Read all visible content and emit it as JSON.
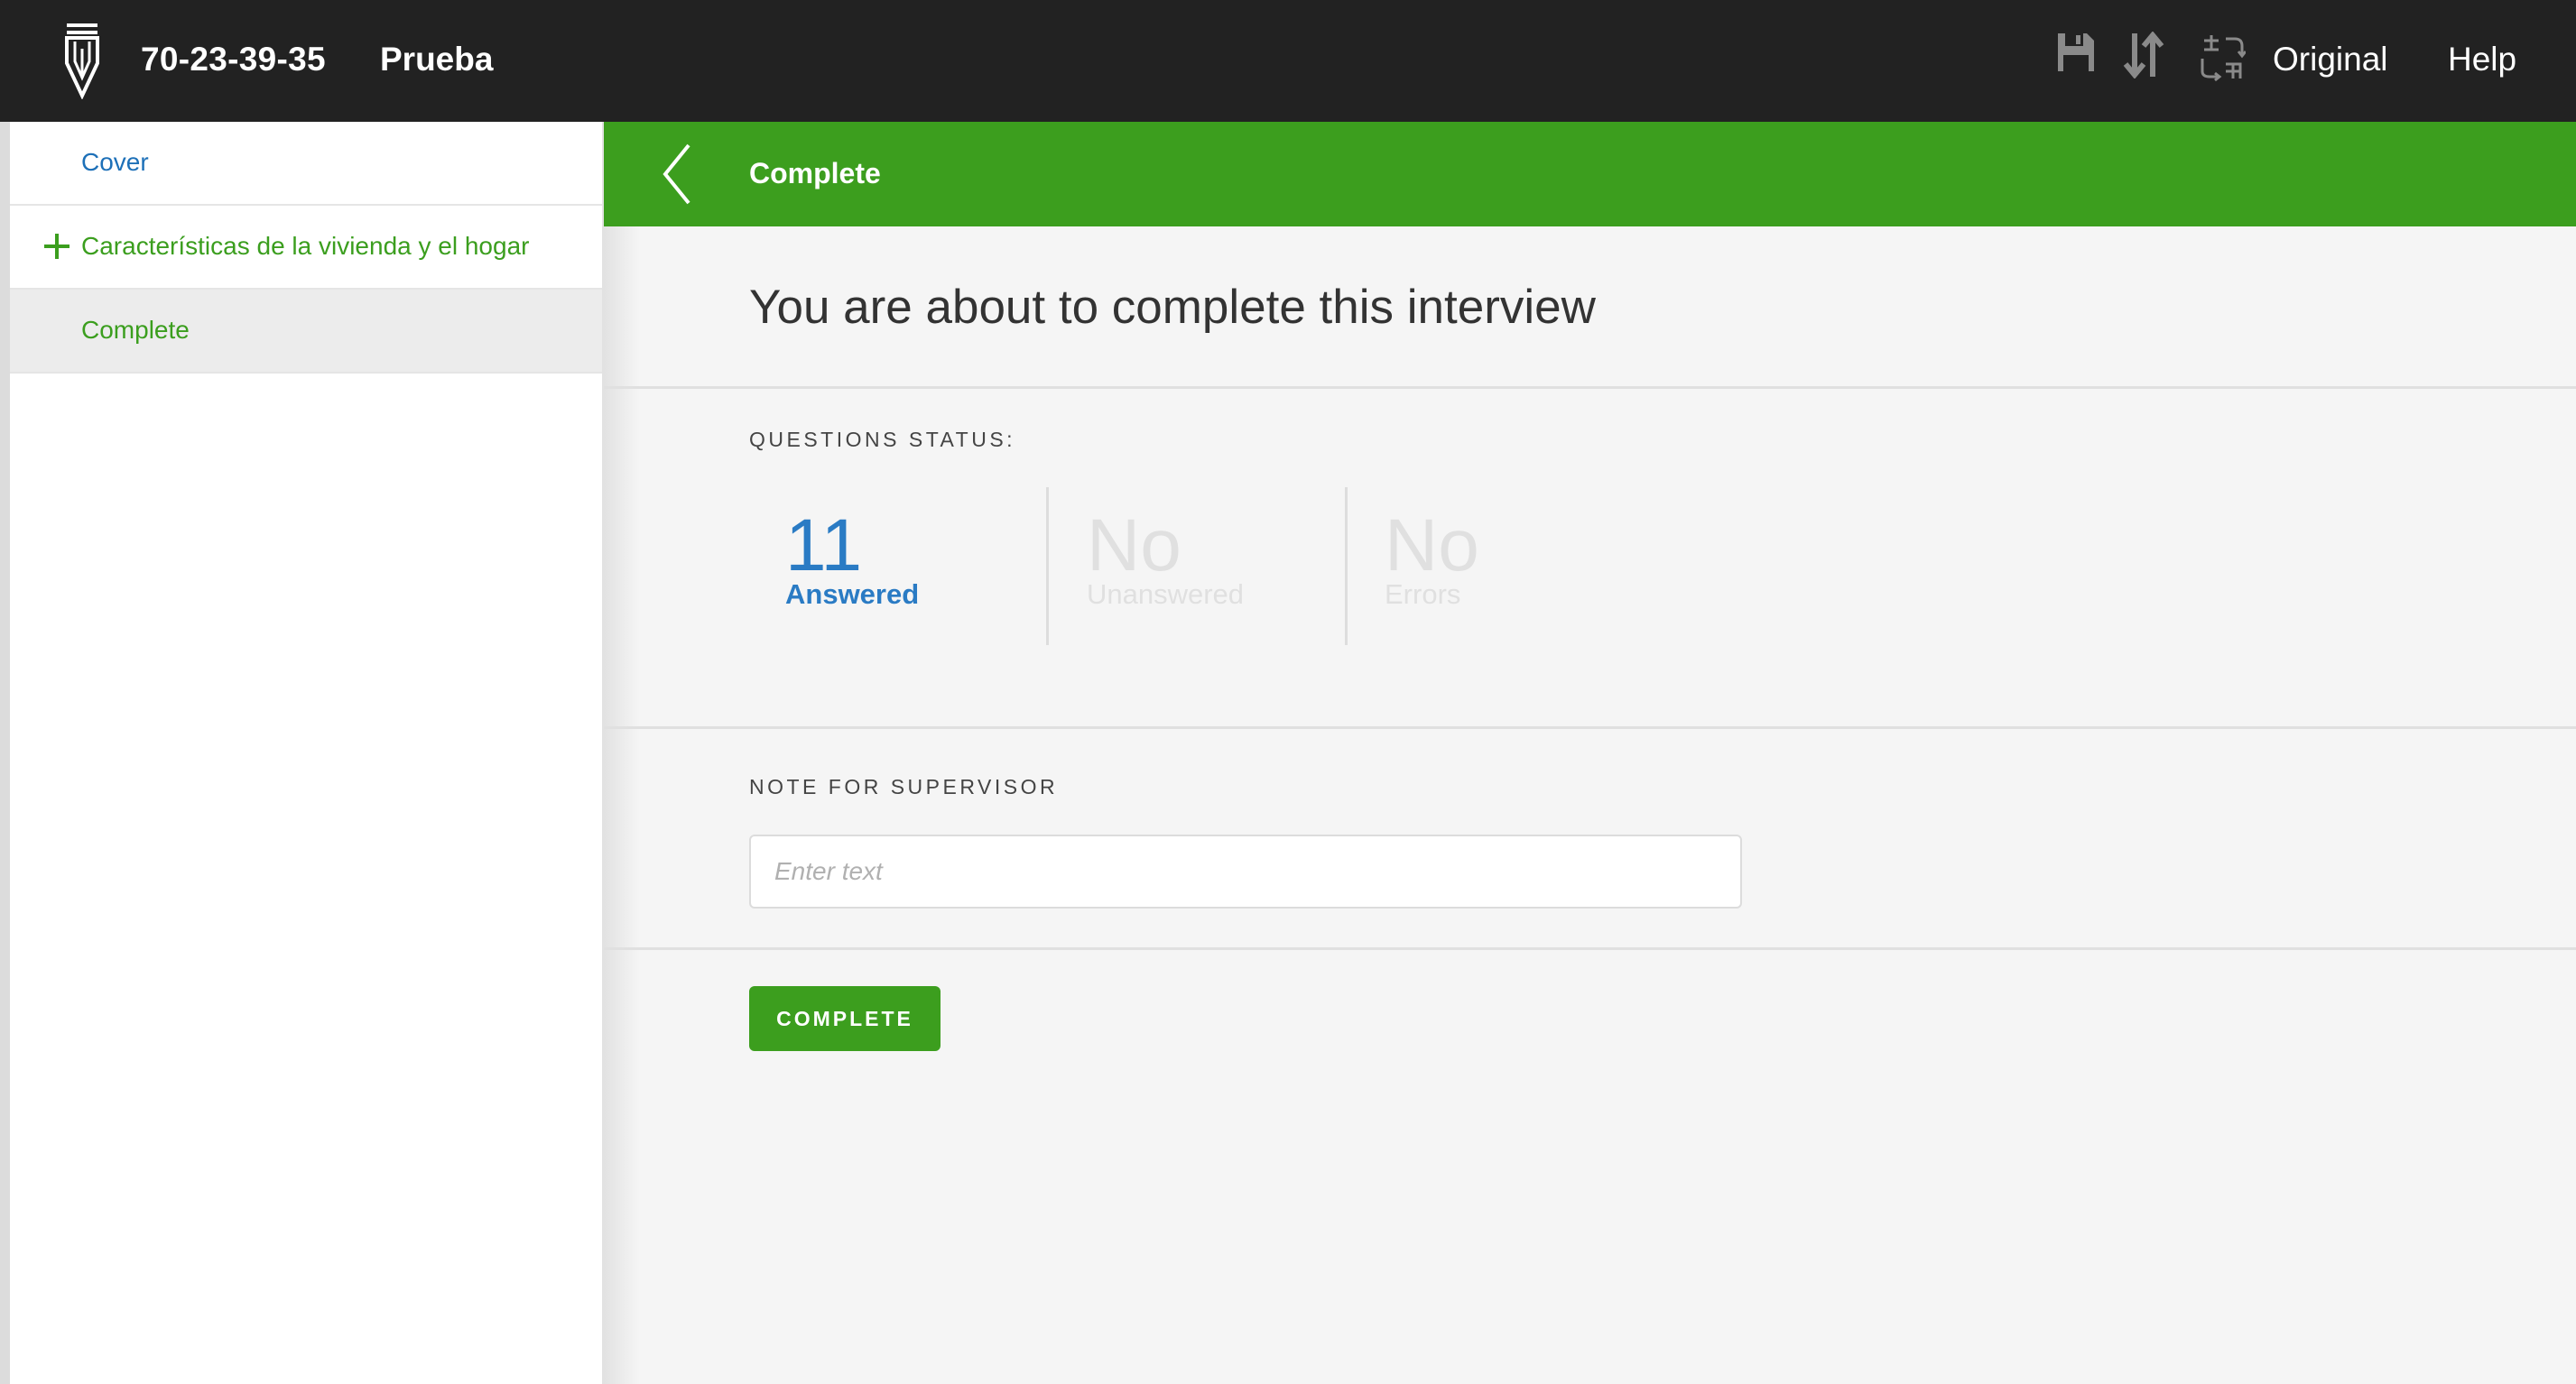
{
  "header": {
    "logo_icon": "pen-shield-icon",
    "interview_id": "70-23-39-35",
    "questionnaire_title": "Prueba",
    "icons": [
      "save-icon",
      "sort-icon",
      "translate-icon"
    ],
    "language_label": "Original",
    "help_label": "Help",
    "background": "#222222"
  },
  "sidebar": {
    "items": [
      {
        "label": "Cover",
        "color": "#1d70b8"
      },
      {
        "label": "Características de la vivienda y el hogar",
        "icon": "plus-icon",
        "color": "#3b9e1e"
      },
      {
        "label": "Complete",
        "color": "#3b9e1e",
        "selected": true
      }
    ]
  },
  "main": {
    "header_title": "Complete",
    "header_color": "#3c9e1e",
    "back_icon": "chevron-left-icon",
    "heading": "You are about to complete this interview",
    "status": {
      "label": "QUESTIONS STATUS:",
      "answered": {
        "value": "11",
        "caption": "Answered",
        "color": "#2a7bc4"
      },
      "unanswered": {
        "value": "No",
        "caption": "Unanswered"
      },
      "errors": {
        "value": "No",
        "caption": "Errors"
      }
    },
    "note": {
      "label": "NOTE FOR SUPERVISOR",
      "placeholder": "Enter text",
      "value": ""
    },
    "complete_button": "COMPLETE"
  }
}
